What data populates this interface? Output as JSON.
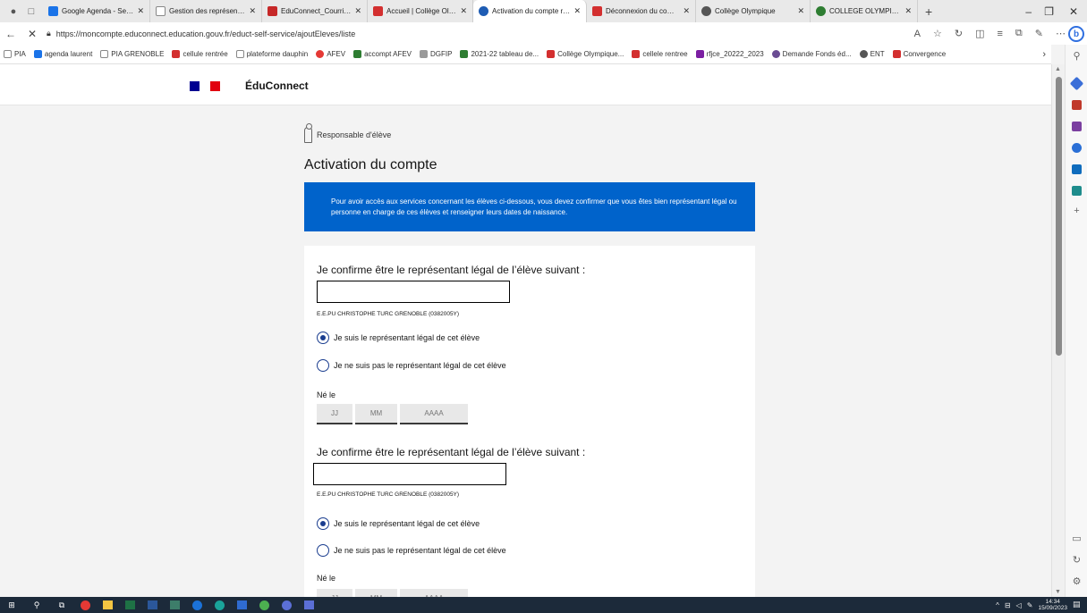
{
  "browser": {
    "tabs": [
      {
        "label": "Google Agenda - Semaine",
        "color": "#1a73e8"
      },
      {
        "label": "Gestion des représentants",
        "color": "#888888"
      },
      {
        "label": "EduConnect_CourrierResp",
        "color": "#c62828"
      },
      {
        "label": "Accueil | Collège Olympique",
        "color": "#d32f2f"
      },
      {
        "label": "Activation du compte resp",
        "color": "#1e5cb3",
        "active": true
      },
      {
        "label": "Déconnexion du compte",
        "color": "#d32f2f"
      },
      {
        "label": "Collège Olympique",
        "color": "#555555"
      },
      {
        "label": "COLLEGE OLYMPIQUE - Pl",
        "color": "#2e7d32"
      }
    ],
    "url": "https://moncompte.educonnect.education.gouv.fr/educt-self-service/ajoutEleves/liste",
    "bookmarks": [
      {
        "label": "PIA",
        "color": "#ffffff"
      },
      {
        "label": "agenda laurent",
        "color": "#1a73e8"
      },
      {
        "label": "PIA GRENOBLE",
        "color": "#ffffff"
      },
      {
        "label": "cellule rentrée",
        "color": "#d32f2f"
      },
      {
        "label": "plateforme dauphin",
        "color": "#ffffff"
      },
      {
        "label": "AFEV",
        "color": "#e53935"
      },
      {
        "label": "accompt AFEV",
        "color": "#2e7d32"
      },
      {
        "label": "DGFIP",
        "color": "#777777"
      },
      {
        "label": "2021-22 tableau de...",
        "color": "#2e7d32"
      },
      {
        "label": "Collège Olympique...",
        "color": "#d32f2f"
      },
      {
        "label": "cellele rentree",
        "color": "#d32f2f"
      },
      {
        "label": "rfjce_20222_2023",
        "color": "#7b1fa2"
      },
      {
        "label": "Demande Fonds éd...",
        "color": "#6a4c93"
      },
      {
        "label": "ENT",
        "color": "#555555"
      },
      {
        "label": "Convergence",
        "color": "#d32f2f"
      }
    ]
  },
  "header": {
    "brand": "ÉduConnect",
    "flag_colors": [
      "#000091",
      "#ffffff",
      "#e1000f"
    ]
  },
  "page": {
    "role_label": "Responsable d'élève",
    "title": "Activation du compte",
    "notice": "Pour avoir accès aux services concernant les élèves ci-dessous, vous devez confirmer que vous êtes bien représentant légal ou personne en charge de ces élèves et renseigner leurs dates de naissance.",
    "notice_color": "#0063cb"
  },
  "students": [
    {
      "heading": "Je confirme être le représentant légal de l’élève suivant :",
      "name": "",
      "school": "E.E.PU CHRISTOPHE TURC GRENOBLE (0382005Y)",
      "option_yes": "Je suis le représentant légal de cet élève",
      "option_no": "Je ne suis pas le représentant légal de cet élève",
      "selected": "yes",
      "born_label": "Né le",
      "day_placeholder": "JJ",
      "month_placeholder": "MM",
      "year_placeholder": "AAAA"
    },
    {
      "heading": "Je confirme être le représentant légal de l’élève suivant :",
      "name": "",
      "school": "E.E.PU CHRISTOPHE TURC GRENOBLE (0382005Y)",
      "option_yes": "Je suis le représentant légal de cet élève",
      "option_no": "Je ne suis pas le représentant légal de cet élève",
      "selected": "yes",
      "born_label": "Né le",
      "day_placeholder": "JJ",
      "month_placeholder": "MM",
      "year_placeholder": "AAAA"
    }
  ],
  "taskbar": {
    "time": "14:34",
    "date": "15/09/2023"
  }
}
